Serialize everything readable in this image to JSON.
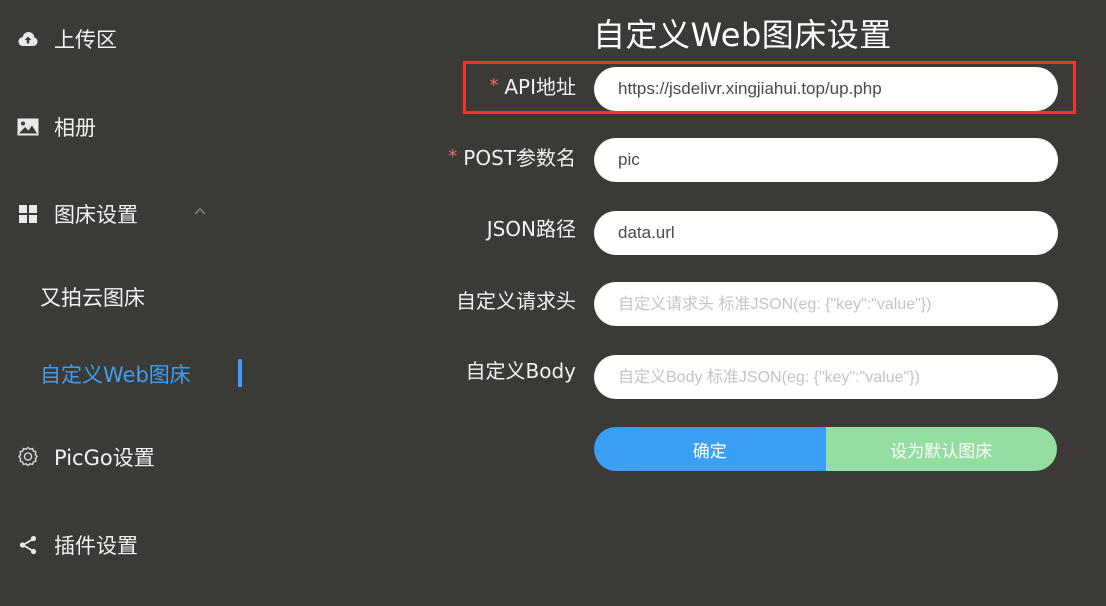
{
  "sidebar": {
    "items": [
      {
        "label": "上传区",
        "icon": "cloud-upload-icon"
      },
      {
        "label": "相册",
        "icon": "picture-icon"
      },
      {
        "label": "图床设置",
        "icon": "grid-icon"
      },
      {
        "label": "又拍云图床"
      },
      {
        "label": "自定义Web图床"
      },
      {
        "label": "PicGo设置",
        "icon": "gear-icon"
      },
      {
        "label": "插件设置",
        "icon": "share-icon"
      }
    ],
    "active_color": "#3a9ff5"
  },
  "main": {
    "title": "自定义Web图床设置",
    "required_mark": "*",
    "fields": [
      {
        "label": "API地址",
        "value": "https://jsdelivr.xingjiahui.top/up.php",
        "placeholder": "",
        "required": true
      },
      {
        "label": "POST参数名",
        "value": "pic",
        "placeholder": "",
        "required": true
      },
      {
        "label": "JSON路径",
        "value": "data.url",
        "placeholder": "",
        "required": false
      },
      {
        "label": "自定义请求头",
        "value": "",
        "placeholder": "自定义请求头 标准JSON(eg: {\"key\":\"value\"})",
        "required": false
      },
      {
        "label": "自定义Body",
        "value": "",
        "placeholder": "自定义Body 标准JSON(eg: {\"key\":\"value\"})",
        "required": false
      }
    ],
    "buttons": {
      "confirm": "确定",
      "set_default": "设为默认图床"
    },
    "highlight_color": "#e8392a"
  }
}
